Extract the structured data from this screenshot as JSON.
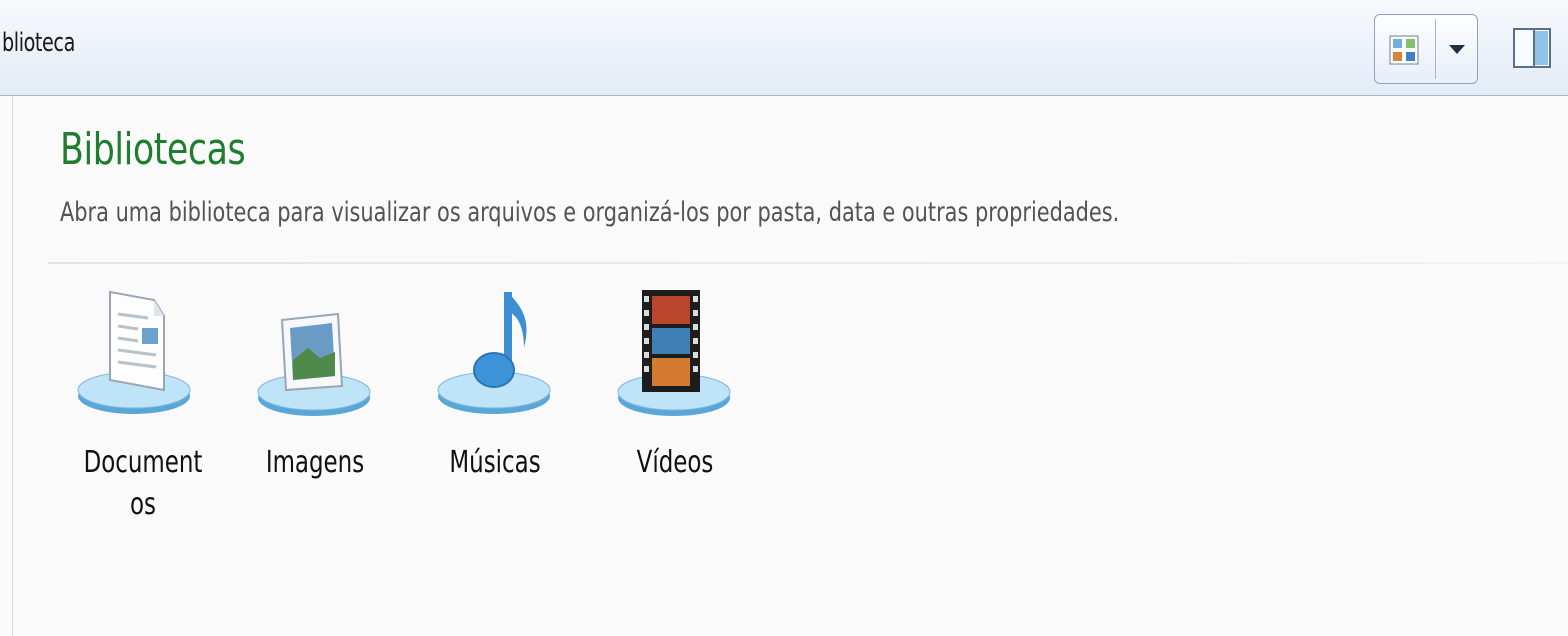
{
  "toolbar": {
    "breadcrumb": "blioteca",
    "view_icon": "view-options-icon",
    "dropdown_icon": "chevron-down-icon",
    "preview_pane_icon": "preview-pane-icon"
  },
  "main": {
    "title": "Bibliotecas",
    "subtitle": "Abra uma biblioteca para visualizar os arquivos e organizá-los por pasta, data e outras propriedades.",
    "libraries": [
      {
        "label": "Document\nos",
        "icon": "documents-library-icon"
      },
      {
        "label": "Imagens",
        "icon": "pictures-library-icon"
      },
      {
        "label": "Músicas",
        "icon": "music-library-icon"
      },
      {
        "label": "Vídeos",
        "icon": "videos-library-icon"
      }
    ]
  },
  "colors": {
    "title_green": "#1e7d2f",
    "toolbar_bg": "#eef3fa"
  }
}
